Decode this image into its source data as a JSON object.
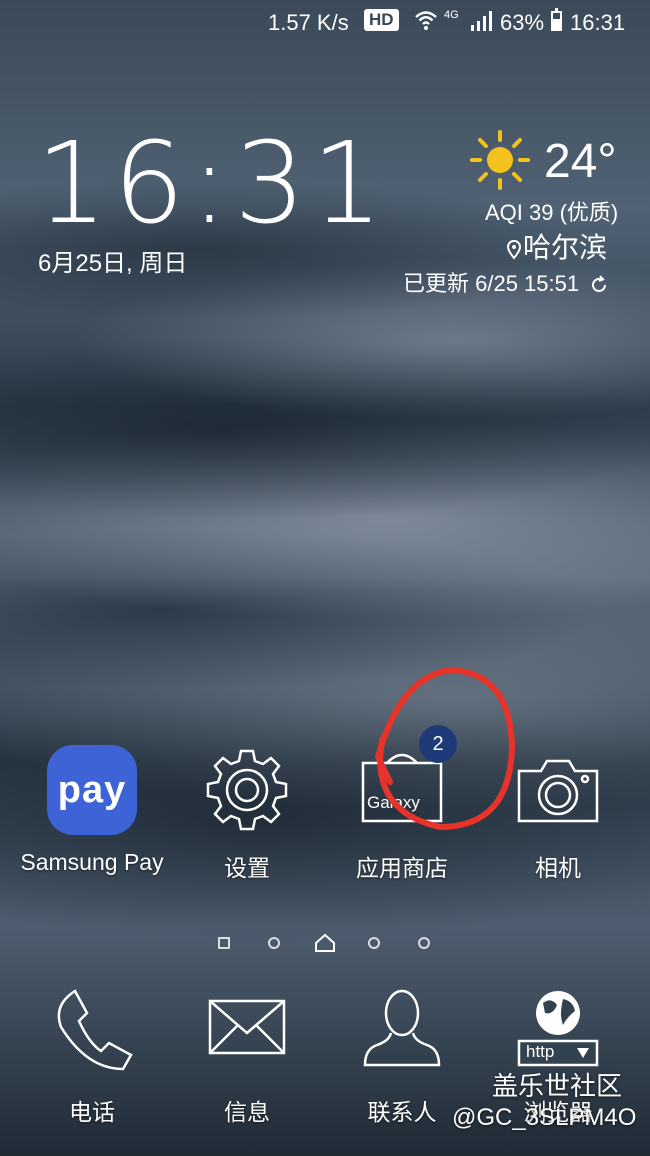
{
  "status_bar": {
    "net_speed": "1.57 K/s",
    "hd": "HD",
    "network": "4G",
    "battery": "63%",
    "battery_level": 0.63,
    "time": "16:31"
  },
  "clock": {
    "time": "16:31",
    "date": "6月25日, 周日"
  },
  "weather": {
    "icon": "sun-icon",
    "temperature": "24°",
    "aqi": "AQI 39 (优质)",
    "city": "哈尔滨",
    "updated": "已更新 6/25  15:51"
  },
  "apps": [
    {
      "label": "Samsung Pay",
      "icon": "pay-icon",
      "icon_text": "pay"
    },
    {
      "label": "设置",
      "icon": "gear-icon"
    },
    {
      "label": "应用商店",
      "icon": "galaxy-store-icon",
      "badge": "2",
      "icon_text": "Galaxy"
    },
    {
      "label": "相机",
      "icon": "camera-icon"
    }
  ],
  "dock": [
    {
      "label": "电话",
      "icon": "phone-icon"
    },
    {
      "label": "信息",
      "icon": "envelope-icon"
    },
    {
      "label": "联系人",
      "icon": "contact-icon"
    },
    {
      "label": "浏览器",
      "icon": "globe-icon",
      "icon_text": "http"
    }
  ],
  "page_indicator": {
    "current_page": 3,
    "total_pages": 5
  },
  "watermark": {
    "text": "盖乐世社区",
    "user": "@GC_3SLPM4O"
  },
  "colors": {
    "pay_blue": "#3d63d6",
    "badge": "#1f3a78",
    "annotation": "#e8332a"
  }
}
